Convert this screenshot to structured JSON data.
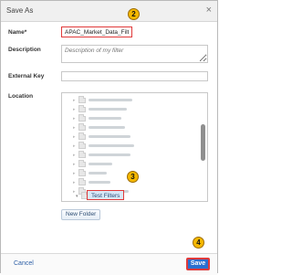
{
  "dialog": {
    "title": "Save As",
    "close_glyph": "×"
  },
  "form": {
    "name_label": "Name*",
    "name_value": "APAC_Market_Data_Filter",
    "description_label": "Description",
    "description_placeholder": "Description of my filter",
    "external_key_label": "External Key",
    "external_key_value": "",
    "location_label": "Location"
  },
  "tree": {
    "selected_item": "Test Filters"
  },
  "buttons": {
    "new_folder": "New Folder",
    "cancel": "Cancel",
    "save": "Save"
  },
  "callouts": [
    "2",
    "3",
    "4"
  ],
  "colors": {
    "highlight_border": "#e03a3a",
    "save_bg": "#2b6fd0",
    "badge_bg": "#f5b800",
    "link": "#2d5fa6"
  },
  "icons": {
    "close": "close-icon",
    "folder": "folder-icon",
    "expand": "chevron-down-icon"
  }
}
